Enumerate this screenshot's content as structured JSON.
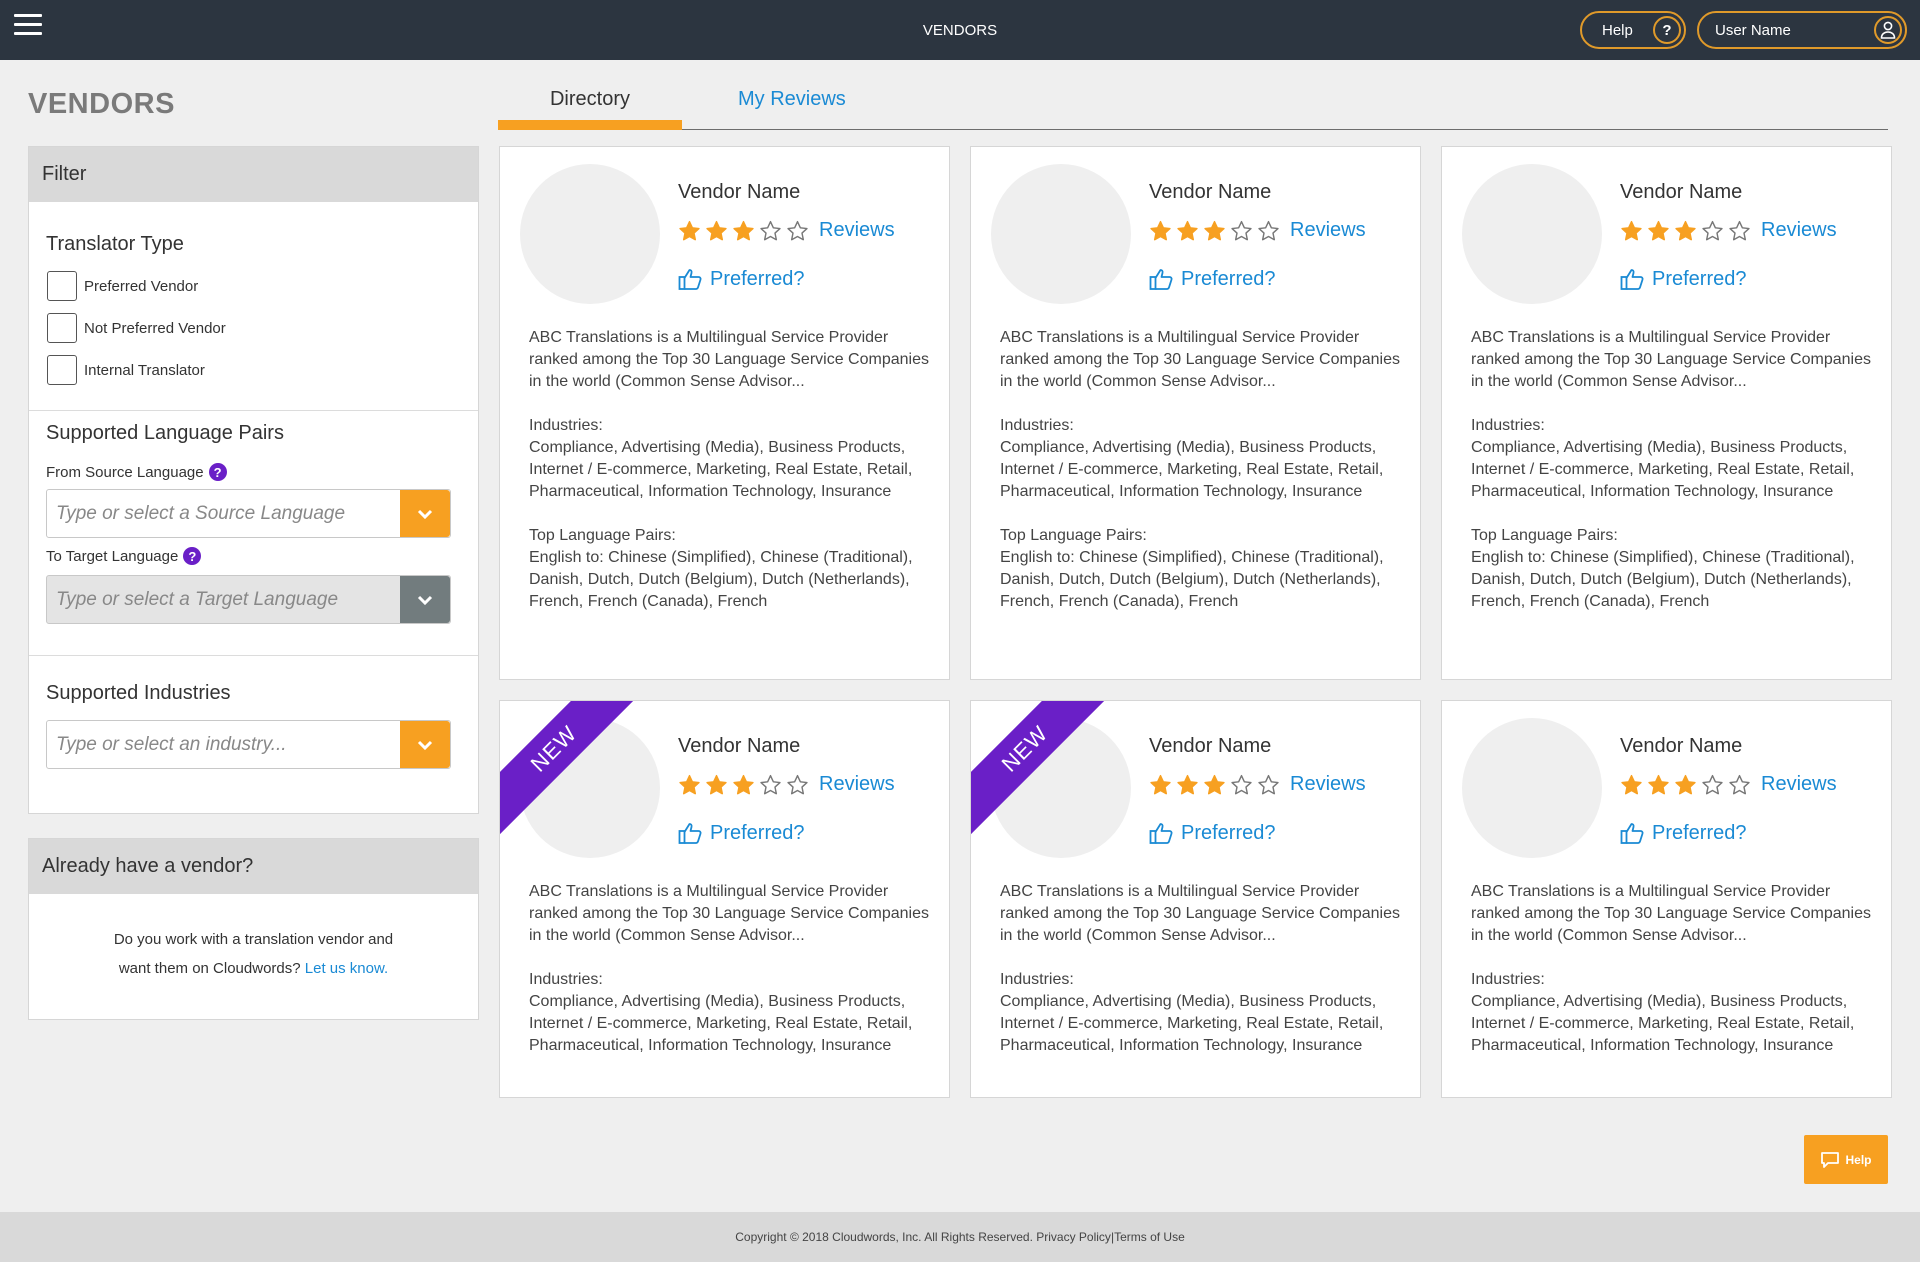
{
  "header": {
    "title": "VENDORS",
    "help_label": "Help",
    "help_icon": "?",
    "user_name": "User Name"
  },
  "page_title": "VENDORS",
  "tabs": [
    {
      "label": "Directory",
      "active": true
    },
    {
      "label": "My Reviews",
      "active": false
    }
  ],
  "filter": {
    "title": "Filter",
    "translator_type": {
      "title": "Translator Type",
      "options": [
        "Preferred Vendor",
        "Not Preferred Vendor",
        "Internal Translator"
      ]
    },
    "language_pairs": {
      "title": "Supported Language Pairs",
      "source_label": "From Source Language",
      "source_placeholder": "Type or select a Source Language",
      "target_label": "To Target Language",
      "target_placeholder": "Type or select a Target Language"
    },
    "industries": {
      "title": "Supported Industries",
      "placeholder": "Type or select an industry..."
    }
  },
  "already_vendor": {
    "title": "Already have a vendor?",
    "line1": "Do you work with a translation vendor and",
    "line2": "want them on Cloudwords?",
    "link": "Let us know."
  },
  "vendors": [
    {
      "name": "Vendor Name",
      "rating": 3,
      "max_rating": 5,
      "new": false,
      "reviews_label": "Reviews",
      "preferred_label": "Preferred?",
      "description": "ABC Translations is a Multilingual Service Provider ranked among the Top 30 Language Service Companies in the world (Common Sense Advisor...",
      "industries_label": "Industries:",
      "industries": "Compliance, Advertising (Media), Business Products, Internet / E-commerce, Marketing, Real Estate, Retail, Pharmaceutical, Information Technology, Insurance",
      "pairs_label": "Top Language Pairs:",
      "pairs": "English to:  Chinese (Simplified), Chinese (Traditional), Danish, Dutch, Dutch (Belgium), Dutch (Netherlands), French, French (Canada), French"
    },
    {
      "name": "Vendor Name",
      "rating": 3,
      "max_rating": 5,
      "new": false,
      "reviews_label": "Reviews",
      "preferred_label": "Preferred?",
      "description": "ABC Translations is a Multilingual Service Provider ranked among the Top 30 Language Service Companies in the world (Common Sense Advisor...",
      "industries_label": "Industries:",
      "industries": "Compliance, Advertising (Media), Business Products, Internet / E-commerce, Marketing, Real Estate, Retail, Pharmaceutical, Information Technology, Insurance",
      "pairs_label": "Top Language Pairs:",
      "pairs": "English to:  Chinese (Simplified), Chinese (Traditional), Danish, Dutch, Dutch (Belgium), Dutch (Netherlands), French, French (Canada), French"
    },
    {
      "name": "Vendor Name",
      "rating": 3,
      "max_rating": 5,
      "new": false,
      "reviews_label": "Reviews",
      "preferred_label": "Preferred?",
      "description": "ABC Translations is a Multilingual Service Provider ranked among the Top 30 Language Service Companies in the world (Common Sense Advisor...",
      "industries_label": "Industries:",
      "industries": "Compliance, Advertising (Media), Business Products, Internet / E-commerce, Marketing, Real Estate, Retail, Pharmaceutical, Information Technology, Insurance",
      "pairs_label": "Top Language Pairs:",
      "pairs": "English to:  Chinese (Simplified), Chinese (Traditional), Danish, Dutch, Dutch (Belgium), Dutch (Netherlands), French, French (Canada), French"
    },
    {
      "name": "Vendor Name",
      "rating": 3,
      "max_rating": 5,
      "new": true,
      "new_label": "NEW",
      "reviews_label": "Reviews",
      "preferred_label": "Preferred?",
      "description": "ABC Translations is a Multilingual Service Provider ranked among the Top 30 Language Service Companies in the world (Common Sense Advisor...",
      "industries_label": "Industries:",
      "industries": "Compliance, Advertising (Media), Business Products, Internet / E-commerce, Marketing, Real Estate, Retail, Pharmaceutical, Information Technology, Insurance"
    },
    {
      "name": "Vendor Name",
      "rating": 3,
      "max_rating": 5,
      "new": true,
      "new_label": "NEW",
      "reviews_label": "Reviews",
      "preferred_label": "Preferred?",
      "description": "ABC Translations is a Multilingual Service Provider ranked among the Top 30 Language Service Companies in the world (Common Sense Advisor...",
      "industries_label": "Industries:",
      "industries": "Compliance, Advertising (Media), Business Products, Internet / E-commerce, Marketing, Real Estate, Retail, Pharmaceutical, Information Technology, Insurance"
    },
    {
      "name": "Vendor Name",
      "rating": 3,
      "max_rating": 5,
      "new": false,
      "reviews_label": "Reviews",
      "preferred_label": "Preferred?",
      "description": "ABC Translations is a Multilingual Service Provider ranked among the Top 30 Language Service Companies in the world (Common Sense Advisor...",
      "industries_label": "Industries:",
      "industries": "Compliance, Advertising (Media), Business Products, Internet / E-commerce, Marketing, Real Estate, Retail, Pharmaceutical, Information Technology, Insurance"
    }
  ],
  "help_widget": {
    "label": "Help"
  },
  "footer": {
    "copyright": "Copyright © 2018 Cloudwords, Inc. All Rights Reserved.",
    "privacy": "Privacy Policy",
    "separator": "|",
    "terms": "Terms of Use"
  },
  "colors": {
    "topbar": "#2c3540",
    "accent": "#f7a021",
    "link": "#1a8ad4",
    "ribbon": "#6a1fc7"
  }
}
